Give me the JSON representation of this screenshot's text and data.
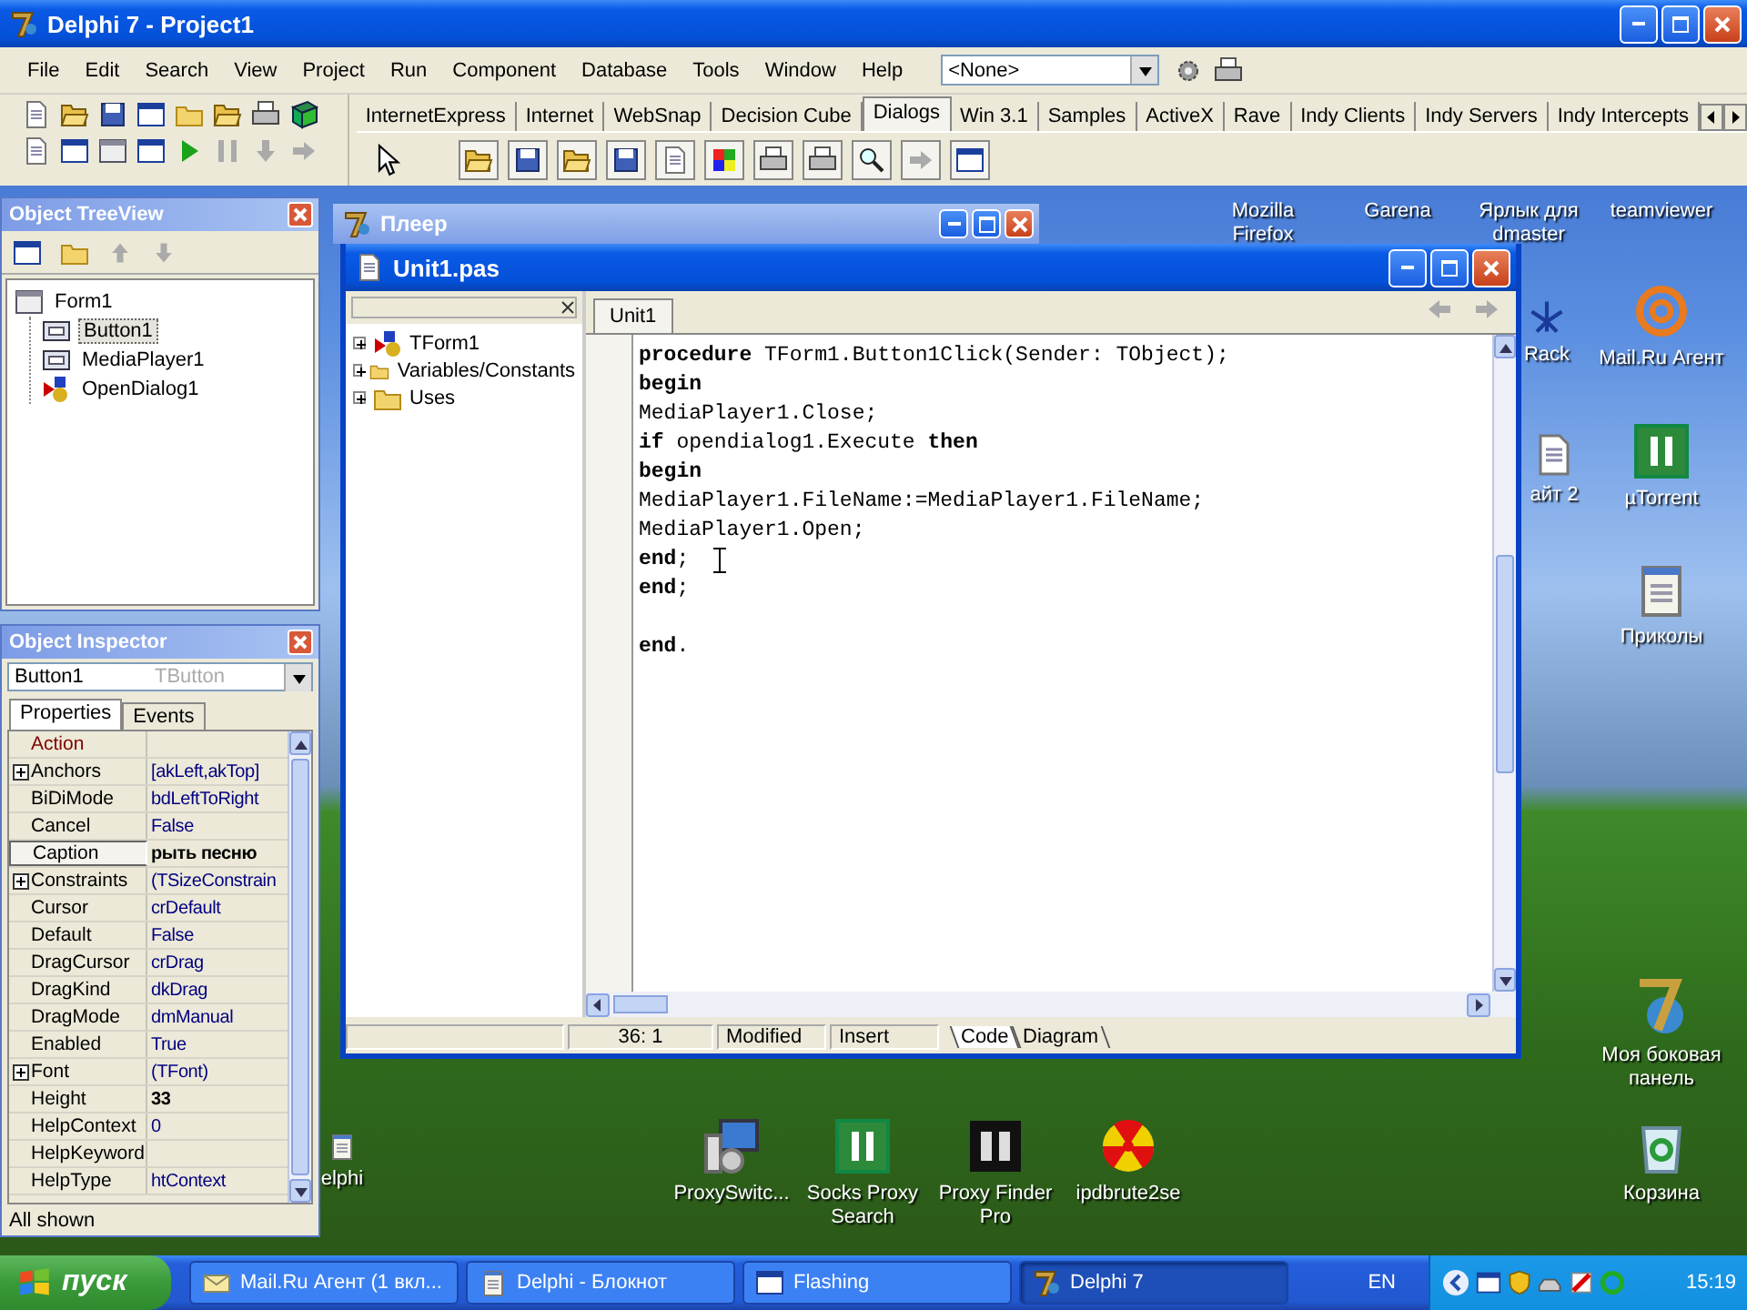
{
  "main_window": {
    "title": "Delphi 7 - Project1",
    "menu": [
      "File",
      "Edit",
      "Search",
      "View",
      "Project",
      "Run",
      "Component",
      "Database",
      "Tools",
      "Window",
      "Help"
    ],
    "component_combo": "<None>",
    "palette_tabs": [
      {
        "label": "InternetExpress",
        "selected": false
      },
      {
        "label": "Internet",
        "selected": false
      },
      {
        "label": "WebSnap",
        "selected": false
      },
      {
        "label": "Decision Cube",
        "selected": false
      },
      {
        "label": "Dialogs",
        "selected": true
      },
      {
        "label": "Win 3.1",
        "selected": false
      },
      {
        "label": "Samples",
        "selected": false
      },
      {
        "label": "ActiveX",
        "selected": false
      },
      {
        "label": "Rave",
        "selected": false
      },
      {
        "label": "Indy Clients",
        "selected": false
      },
      {
        "label": "Indy Servers",
        "selected": false
      },
      {
        "label": "Indy Intercepts",
        "selected": false
      }
    ]
  },
  "object_treeview": {
    "title": "Object TreeView",
    "tree": [
      {
        "label": "Form1",
        "kind": "form",
        "selected": false,
        "children": [
          {
            "label": "Button1",
            "kind": "control",
            "selected": true
          },
          {
            "label": "MediaPlayer1",
            "kind": "control",
            "selected": false
          },
          {
            "label": "OpenDialog1",
            "kind": "dialog",
            "selected": false
          }
        ]
      }
    ]
  },
  "object_inspector": {
    "title": "Object Inspector",
    "component": "Button1",
    "component_type": "TButton",
    "tabs": [
      {
        "label": "Properties",
        "selected": true
      },
      {
        "label": "Events",
        "selected": false
      }
    ],
    "properties": [
      {
        "name": "Action",
        "kind": "reference",
        "expandable": false,
        "selected": false
      },
      {
        "name": "Anchors",
        "value": "[akLeft,akTop]",
        "kind": "plain",
        "expandable": true,
        "selected": false,
        "modified": false
      },
      {
        "name": "BiDiMode",
        "value": "bdLeftToRight",
        "kind": "plain",
        "expandable": false,
        "selected": false,
        "modified": false
      },
      {
        "name": "Cancel",
        "value": "False",
        "kind": "plain",
        "expandable": false,
        "selected": false,
        "modified": false
      },
      {
        "name": "Caption",
        "value": "рыть песню",
        "kind": "plain",
        "expandable": false,
        "selected": true,
        "modified": true
      },
      {
        "name": "Constraints",
        "value": "(TSizeConstrain",
        "kind": "plain",
        "expandable": true,
        "selected": false,
        "modified": false
      },
      {
        "name": "Cursor",
        "value": "crDefault",
        "kind": "plain",
        "expandable": false,
        "selected": false,
        "modified": false
      },
      {
        "name": "Default",
        "value": "False",
        "kind": "plain",
        "expandable": false,
        "selected": false,
        "modified": false
      },
      {
        "name": "DragCursor",
        "value": "crDrag",
        "kind": "plain",
        "expandable": false,
        "selected": false,
        "modified": false
      },
      {
        "name": "DragKind",
        "value": "dkDrag",
        "kind": "plain",
        "expandable": false,
        "selected": false,
        "modified": false
      },
      {
        "name": "DragMode",
        "value": "dmManual",
        "kind": "plain",
        "expandable": false,
        "selected": false,
        "modified": false
      },
      {
        "name": "Enabled",
        "value": "True",
        "kind": "plain",
        "expandable": false,
        "selected": false,
        "modified": false
      },
      {
        "name": "Font",
        "value": "(TFont)",
        "kind": "plain",
        "expandable": true,
        "selected": false,
        "modified": false
      },
      {
        "name": "Height",
        "value": "33",
        "kind": "plain",
        "expandable": false,
        "selected": false,
        "modified": true
      },
      {
        "name": "HelpContext",
        "value": "0",
        "kind": "plain",
        "expandable": false,
        "selected": false,
        "modified": false
      },
      {
        "name": "HelpKeyword",
        "kind": "plain",
        "expandable": false,
        "selected": false
      },
      {
        "name": "HelpType",
        "value": "htContext",
        "kind": "plain",
        "expandable": false,
        "selected": false,
        "modified": false
      }
    ],
    "status": "All shown"
  },
  "player_window": {
    "title": "Плеер"
  },
  "editor_window": {
    "title": "Unit1.pas",
    "explorer": [
      {
        "label": "TForm1",
        "kind": "class",
        "expanded": false
      },
      {
        "label": "Variables/Constants",
        "kind": "folder",
        "expanded": false
      },
      {
        "label": "Uses",
        "kind": "folder",
        "expanded": false
      }
    ],
    "tabs": [
      {
        "label": "Unit1",
        "selected": true
      }
    ],
    "code_blocks": [
      {
        "lines": [
          "**procedure** TForm1.Button1Click(Sender: TObject);",
          "**begin**",
          "MediaPlayer1.Close;",
          "**if** opendialog1.Execute **then**",
          "**begin**",
          "MediaPlayer1.FileName:=MediaPlayer1.FileName;",
          "MediaPlayer1.Open;",
          "**end**;",
          "**end**;"
        ]
      },
      {
        "lines": [
          "**end**."
        ]
      }
    ],
    "status": {
      "position": "36: 1",
      "modified": "Modified",
      "mode": "Insert"
    },
    "view_tabs": [
      {
        "label": "Code",
        "selected": true
      },
      {
        "label": "Diagram",
        "selected": false
      }
    ]
  },
  "desktop_icons": [
    {
      "label": "Mozilla Firefox",
      "kind": "hidden"
    },
    {
      "label": "Garena",
      "kind": "hidden"
    },
    {
      "label": "Ярлык для\ndmaster",
      "kind": "hidden"
    },
    {
      "label": "teamviewer",
      "kind": "hidden"
    },
    {
      "label": "Rack",
      "kind": "network"
    },
    {
      "label": "Mail.Ru Агент",
      "kind": "at-sign"
    },
    {
      "label": "айт 2",
      "kind": "page"
    },
    {
      "label": "µTorrent",
      "kind": "green-tile"
    },
    {
      "label": "Приколы",
      "kind": "notepad"
    },
    {
      "label": "Моя боковая\nпанель",
      "kind": "globe"
    },
    {
      "label": "elphi",
      "kind": "notepad"
    },
    {
      "label": "ProxySwitc...",
      "kind": "computer"
    },
    {
      "label": "Socks Proxy\nSearch",
      "kind": "green-tile"
    },
    {
      "label": "Proxy Finder\nPro",
      "kind": "black-tile"
    },
    {
      "label": "ipdbrute2se",
      "kind": "radiation"
    },
    {
      "label": "Корзина",
      "kind": "recycle-bin"
    }
  ],
  "taskbar": {
    "start": "пуск",
    "tasks": [
      {
        "label": "Mail.Ru Агент (1 вкл...",
        "kind": "envelope",
        "selected": false
      },
      {
        "label": "Delphi - Блокнот",
        "kind": "notepad",
        "selected": false
      },
      {
        "label": "Flashing",
        "kind": "window",
        "selected": false
      },
      {
        "label": "Delphi 7",
        "kind": "logo",
        "selected": true
      }
    ],
    "language": "EN",
    "clock": "15:19"
  }
}
